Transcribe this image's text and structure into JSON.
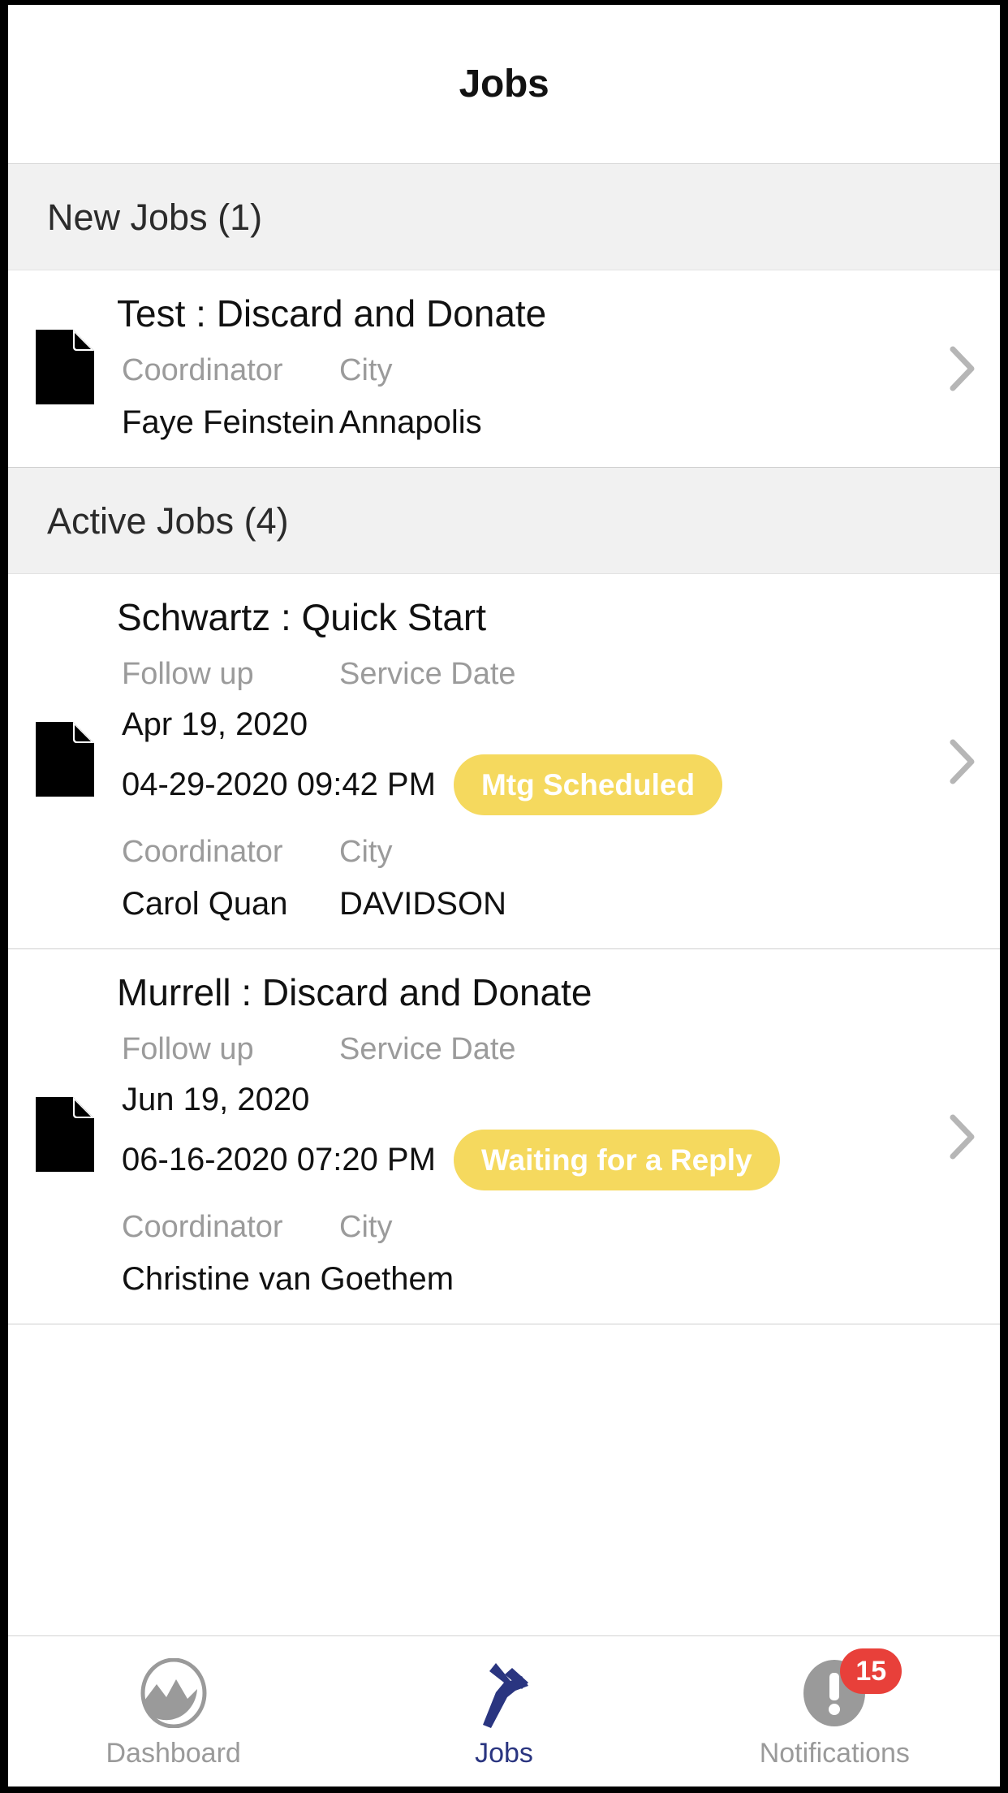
{
  "header": {
    "title": "Jobs"
  },
  "sections": [
    {
      "heading": "New Jobs (1)",
      "jobs": [
        {
          "title": "Test : Discard and Donate",
          "icon": "document-icon",
          "has_dates": false,
          "coordinator_label": "Coordinator",
          "city_label": "City",
          "coordinator": "Faye Feinstein",
          "city": "Annapolis",
          "status": "",
          "chevron": "chevron-right-icon"
        }
      ]
    },
    {
      "heading": "Active Jobs (4)",
      "jobs": [
        {
          "title": "Schwartz : Quick Start",
          "icon": "document-icon",
          "has_dates": true,
          "followup_label": "Follow up",
          "service_date_label": "Service Date",
          "followup_date": "Apr 19, 2020",
          "service_date": "04-29-2020 09:42 PM",
          "status": "Mtg Scheduled",
          "coordinator_label": "Coordinator",
          "city_label": "City",
          "coordinator": "Carol Quan",
          "city": "DAVIDSON",
          "chevron": "chevron-right-icon"
        },
        {
          "title": "Murrell : Discard and Donate",
          "icon": "document-icon",
          "has_dates": true,
          "followup_label": "Follow up",
          "service_date_label": "Service Date",
          "followup_date": "Jun 19, 2020",
          "service_date": "06-16-2020 07:20 PM",
          "status": "Waiting for a Reply",
          "coordinator_label": "Coordinator",
          "city_label": "City",
          "coordinator": "Christine van Goethem",
          "city": "",
          "chevron": "chevron-right-icon"
        }
      ]
    }
  ],
  "tabbar": {
    "tabs": [
      {
        "label": "Dashboard",
        "icon": "dashboard-icon",
        "active": false
      },
      {
        "label": "Jobs",
        "icon": "hammer-icon",
        "active": true
      },
      {
        "label": "Notifications",
        "icon": "alert-circle-icon",
        "active": false,
        "badge": "15"
      }
    ]
  },
  "colors": {
    "status_yellow": "#f5d95e",
    "badge_red": "#e8403a",
    "active_tab": "#2a3580",
    "section_bg": "#f1f1f1"
  }
}
